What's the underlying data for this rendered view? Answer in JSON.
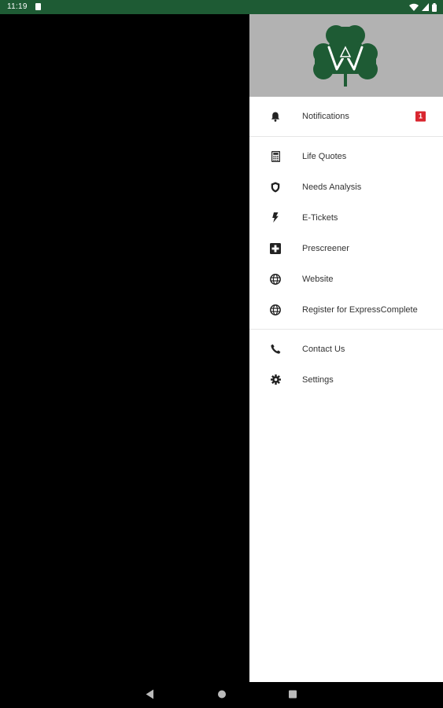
{
  "status_bar": {
    "time": "11:19"
  },
  "drawer": {
    "logo": {
      "name": "company-logo",
      "color": "#1e5b34"
    },
    "groups": [
      [
        {
          "id": "notifications",
          "label": "Notifications",
          "icon": "bell-icon",
          "badge": "1"
        }
      ],
      [
        {
          "id": "life-quotes",
          "label": "Life Quotes",
          "icon": "calculator-icon"
        },
        {
          "id": "needs-analysis",
          "label": "Needs Analysis",
          "icon": "shield-icon"
        },
        {
          "id": "e-tickets",
          "label": "E-Tickets",
          "icon": "bolt-icon"
        },
        {
          "id": "prescreener",
          "label": "Prescreener",
          "icon": "medical-cross-icon"
        },
        {
          "id": "website",
          "label": "Website",
          "icon": "globe-icon"
        },
        {
          "id": "register",
          "label": "Register for ExpressComplete",
          "icon": "globe-icon"
        }
      ],
      [
        {
          "id": "contact-us",
          "label": "Contact Us",
          "icon": "phone-icon"
        },
        {
          "id": "settings",
          "label": "Settings",
          "icon": "gear-icon"
        }
      ]
    ]
  },
  "colors": {
    "status_bar": "#1e5b34",
    "badge": "#d9262f",
    "header_bg": "#b2b2b2"
  }
}
